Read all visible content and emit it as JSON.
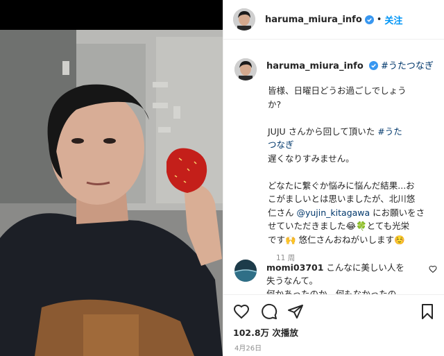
{
  "post": {
    "username": "haruma_miura_info",
    "follow_label": "关注",
    "separator": "•",
    "hashtag_header": "#うたつなぎ",
    "caption_lines": [
      "皆様、日曜日どうお過ごしでしょう",
      "か?"
    ],
    "caption_p2_a": "JUJU さんから回して頂いた ",
    "caption_p2_hashtag_1": "#うた",
    "caption_p2_hashtag_2": "つなぎ",
    "caption_p2_b": "遅くなりすみません。",
    "caption_p3_line1": "どなたに繋ぐか悩みに悩んだ結果...お",
    "caption_p3_line2": "こがましいとは思いましたが、北川悠",
    "caption_p3_line3a": "仁さん ",
    "caption_p3_mention": "@yujin_kitagawa",
    "caption_p3_line3b": " にお願いをさ",
    "caption_p3_line4": "せていただきました😂🍀とても光栄",
    "caption_p3_line5": "です🙌      悠仁さんおねがいします☺️",
    "time_ago": "11 周"
  },
  "comment": {
    "username": "momi03701",
    "text_line1": " こんなに美しい人を",
    "text_line2": "失うなんて。",
    "text_line3": "何かあったのか、何もなかったの"
  },
  "footer": {
    "likes": "102.8万 次播放",
    "date": "4月26日"
  },
  "icons": {
    "like": "heart-icon",
    "comment": "comment-bubble-icon",
    "share": "paper-plane-icon",
    "save": "bookmark-icon",
    "verified": "verified-badge-icon"
  },
  "colors": {
    "link": "#00376b",
    "follow": "#0095f6",
    "verified": "#3897f0",
    "muted": "#8e8e8e"
  }
}
